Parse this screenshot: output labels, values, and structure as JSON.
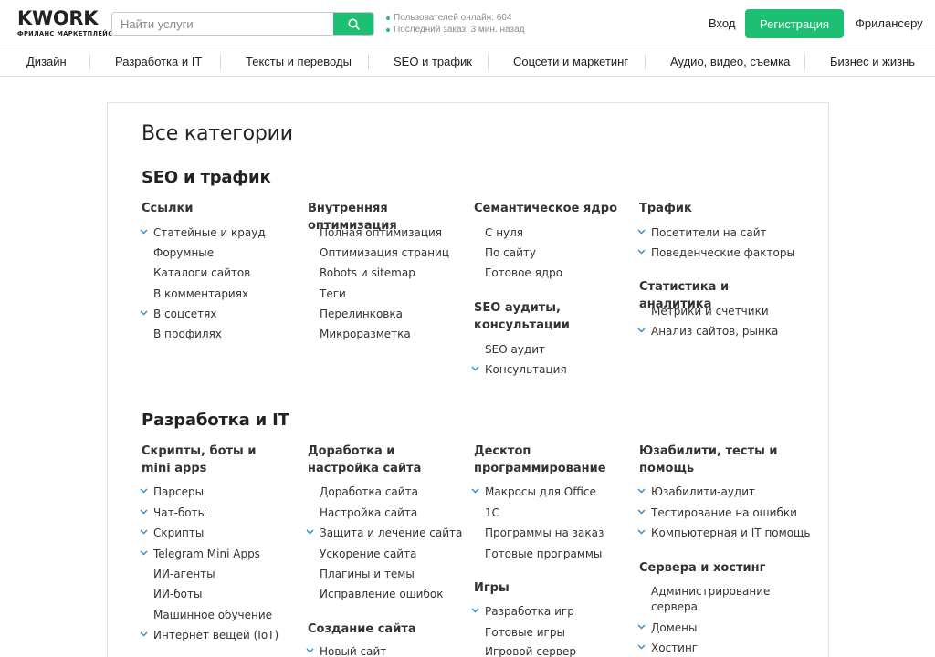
{
  "header": {
    "logo_main": "KWORK",
    "logo_sub": "ФРИЛАНС МАРКЕТПЛЕЙС",
    "search_placeholder": "Найти услуги",
    "stat_online": "Пользователей онлайн: 604",
    "stat_last_order": "Последний заказ: 3 мин. назад",
    "login": "Вход",
    "register": "Регистрация",
    "freelancer": "Фрилансеру",
    "accent_color": "#1dbf73"
  },
  "nav": [
    "Дизайн",
    "Разработка и IT",
    "Тексты и переводы",
    "SEO и трафик",
    "Соцсети и маркетинг",
    "Аудио, видео, съемка",
    "Бизнес и жизнь"
  ],
  "page_title": "Все категории",
  "sections": [
    {
      "title": "SEO и трафик",
      "groups": [
        {
          "title": "Ссылки",
          "items": [
            {
              "label": "Статейные и крауд",
              "expandable": true
            },
            {
              "label": "Форумные",
              "expandable": false
            },
            {
              "label": "Каталоги сайтов",
              "expandable": false
            },
            {
              "label": "В комментариях",
              "expandable": false
            },
            {
              "label": "В соцсетях",
              "expandable": true
            },
            {
              "label": "В профилях",
              "expandable": false
            }
          ]
        },
        {
          "title": "Внутренняя оптимизация",
          "items": [
            {
              "label": "Полная оптимизация",
              "expandable": false
            },
            {
              "label": "Оптимизация страниц",
              "expandable": false
            },
            {
              "label": "Robots и sitemap",
              "expandable": false
            },
            {
              "label": "Теги",
              "expandable": false
            },
            {
              "label": "Перелинковка",
              "expandable": false
            },
            {
              "label": "Микроразметка",
              "expandable": false
            }
          ]
        },
        {
          "title": "Семантическое ядро",
          "items": [
            {
              "label": "С нуля",
              "expandable": false
            },
            {
              "label": "По сайту",
              "expandable": false
            },
            {
              "label": "Готовое ядро",
              "expandable": false
            }
          ]
        },
        {
          "title": "SEO аудиты, консультации",
          "items": [
            {
              "label": "SEO аудит",
              "expandable": false
            },
            {
              "label": "Консультация",
              "expandable": true
            }
          ]
        },
        {
          "title": "Трафик",
          "items": [
            {
              "label": "Посетители на сайт",
              "expandable": true
            },
            {
              "label": "Поведенческие факторы",
              "expandable": true
            }
          ]
        },
        {
          "title": "Статистика и аналитика",
          "items": [
            {
              "label": "Метрики и счетчики",
              "expandable": false
            },
            {
              "label": "Анализ сайтов, рынка",
              "expandable": true
            }
          ]
        }
      ]
    },
    {
      "title": "Разработка и IT",
      "groups": [
        {
          "title": "Скрипты, боты и mini apps",
          "items": [
            {
              "label": "Парсеры",
              "expandable": true
            },
            {
              "label": "Чат-боты",
              "expandable": true
            },
            {
              "label": "Скрипты",
              "expandable": true
            },
            {
              "label": "Telegram Mini Apps",
              "expandable": true
            },
            {
              "label": "ИИ-агенты",
              "expandable": false
            },
            {
              "label": "ИИ-боты",
              "expandable": false
            },
            {
              "label": "Машинное обучение",
              "expandable": false
            },
            {
              "label": "Интернет вещей (IoT)",
              "expandable": true
            }
          ]
        },
        {
          "title": "Доработка и настройка сайта",
          "items": [
            {
              "label": "Доработка сайта",
              "expandable": false
            },
            {
              "label": "Настройка сайта",
              "expandable": false
            },
            {
              "label": "Защита и лечение сайта",
              "expandable": true
            },
            {
              "label": "Ускорение сайта",
              "expandable": false
            },
            {
              "label": "Плагины и темы",
              "expandable": false
            },
            {
              "label": "Исправление ошибок",
              "expandable": false
            }
          ]
        },
        {
          "title": "Создание сайта",
          "items": [
            {
              "label": "Новый сайт",
              "expandable": true
            }
          ]
        },
        {
          "title": "Десктоп программирование",
          "items": [
            {
              "label": "Макросы для Office",
              "expandable": true
            },
            {
              "label": "1С",
              "expandable": false
            },
            {
              "label": "Программы на заказ",
              "expandable": false
            },
            {
              "label": "Готовые программы",
              "expandable": false
            }
          ]
        },
        {
          "title": "Игры",
          "items": [
            {
              "label": "Разработка игр",
              "expandable": true
            },
            {
              "label": "Готовые игры",
              "expandable": false
            },
            {
              "label": "Игровой сервер",
              "expandable": false
            }
          ]
        },
        {
          "title": "Юзабилити, тесты и помощь",
          "items": [
            {
              "label": "Юзабилити-аудит",
              "expandable": true
            },
            {
              "label": "Тестирование на ошибки",
              "expandable": true
            },
            {
              "label": "Компьютерная и IT помощь",
              "expandable": true
            }
          ]
        },
        {
          "title": "Сервера и хостинг",
          "items": [
            {
              "label": "Администрирование сервера",
              "expandable": false
            },
            {
              "label": "Домены",
              "expandable": true
            },
            {
              "label": "Хостинг",
              "expandable": true
            }
          ]
        }
      ]
    }
  ]
}
